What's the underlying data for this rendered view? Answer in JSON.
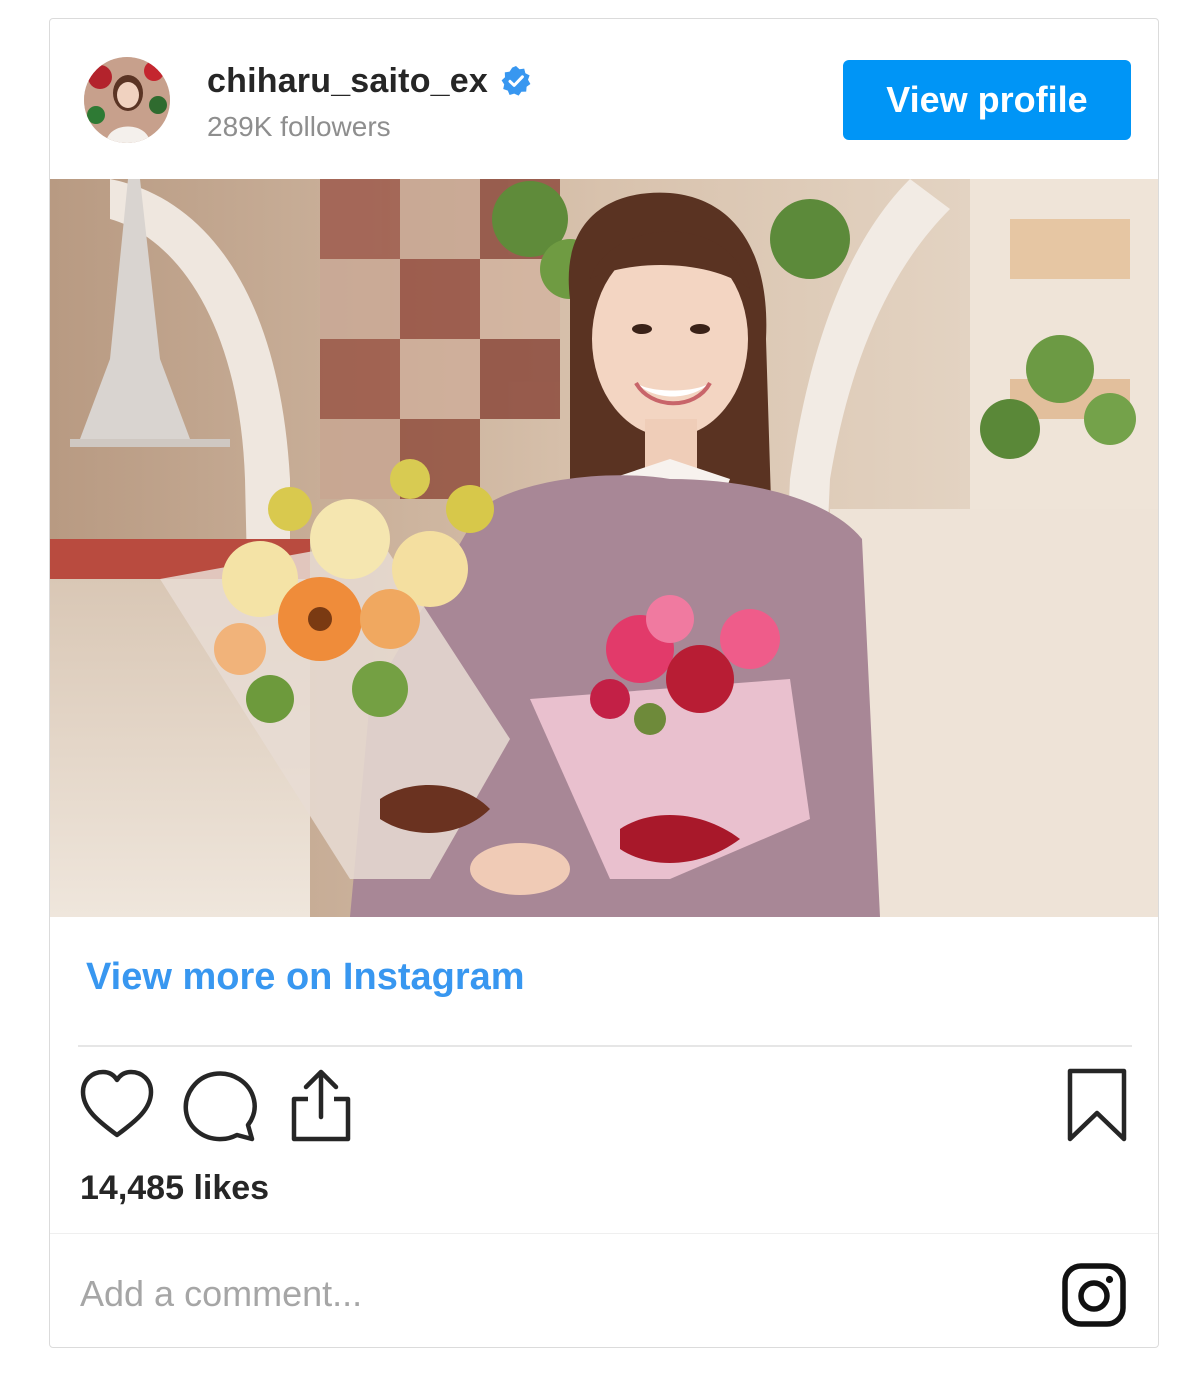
{
  "header": {
    "username": "chiharu_saito_ex",
    "verified_icon": "verified-badge-icon",
    "followers": "289K followers",
    "view_profile_label": "View profile"
  },
  "post": {
    "view_more_label": "View more on Instagram",
    "likes": "14,485 likes"
  },
  "actions": {
    "icons": [
      "heart-icon",
      "comment-icon",
      "share-icon",
      "bookmark-icon"
    ]
  },
  "comment": {
    "placeholder": "Add a comment..."
  },
  "colors": {
    "accent": "#0095f6",
    "link": "#3897f0",
    "verified": "#3897f0",
    "text": "#262626",
    "muted": "#8e8e8e"
  }
}
